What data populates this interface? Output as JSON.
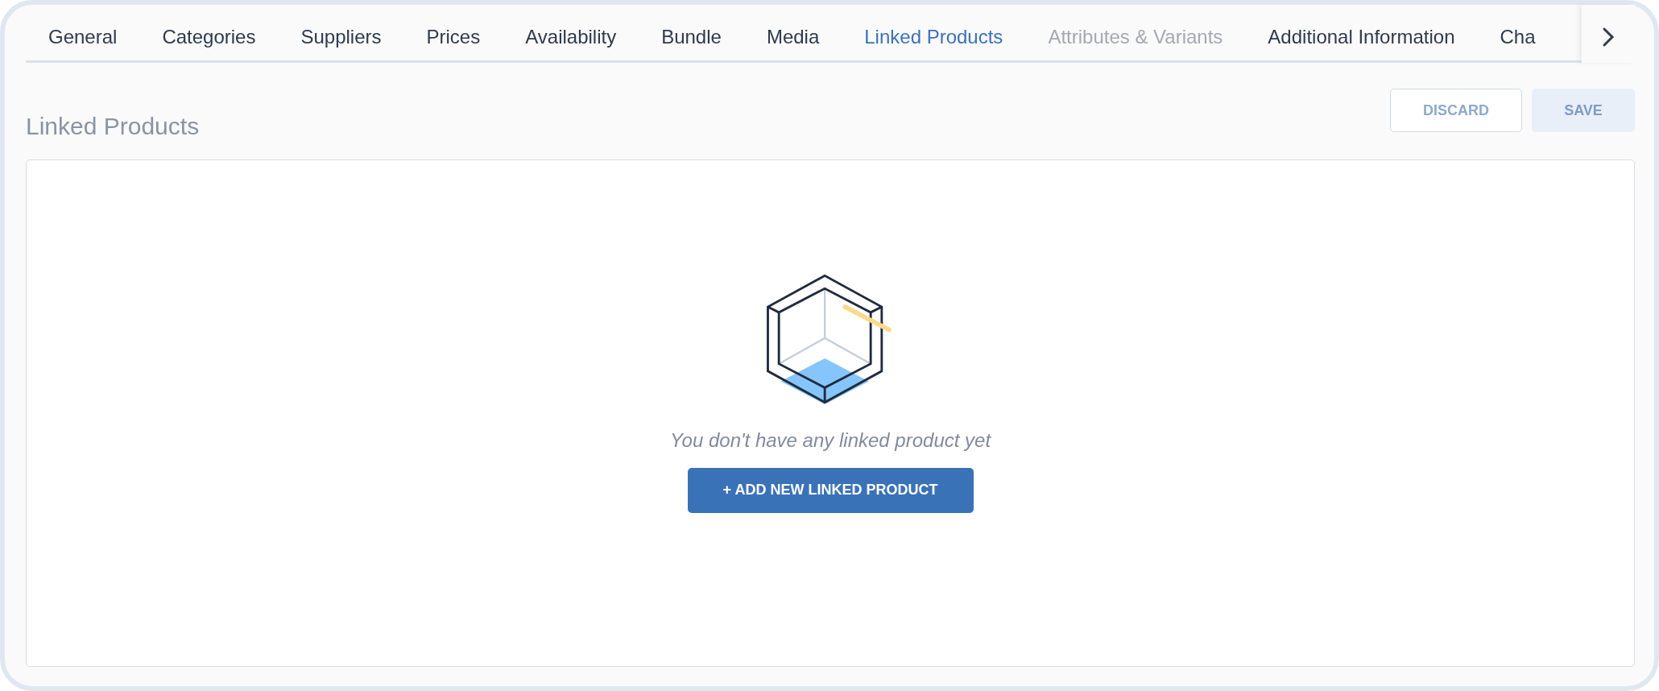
{
  "tabs": [
    {
      "label": "General",
      "selected": false,
      "disabled": false
    },
    {
      "label": "Categories",
      "selected": false,
      "disabled": false
    },
    {
      "label": "Suppliers",
      "selected": false,
      "disabled": false
    },
    {
      "label": "Prices",
      "selected": false,
      "disabled": false
    },
    {
      "label": "Availability",
      "selected": false,
      "disabled": false
    },
    {
      "label": "Bundle",
      "selected": false,
      "disabled": false
    },
    {
      "label": "Media",
      "selected": false,
      "disabled": false
    },
    {
      "label": "Linked Products",
      "selected": true,
      "disabled": false
    },
    {
      "label": "Attributes & Variants",
      "selected": false,
      "disabled": true
    },
    {
      "label": "Additional Information",
      "selected": false,
      "disabled": false
    },
    {
      "label": "Cha",
      "selected": false,
      "disabled": false
    }
  ],
  "section": {
    "title": "Linked Products",
    "actions": [
      {
        "label": "DISCARD",
        "kind": "outline",
        "disabled": true
      },
      {
        "label": "SAVE",
        "kind": "filled",
        "disabled": true
      }
    ]
  },
  "empty_state": {
    "message": "You don't have any linked product yet",
    "button": "+ ADD NEW LINKED PRODUCT"
  }
}
